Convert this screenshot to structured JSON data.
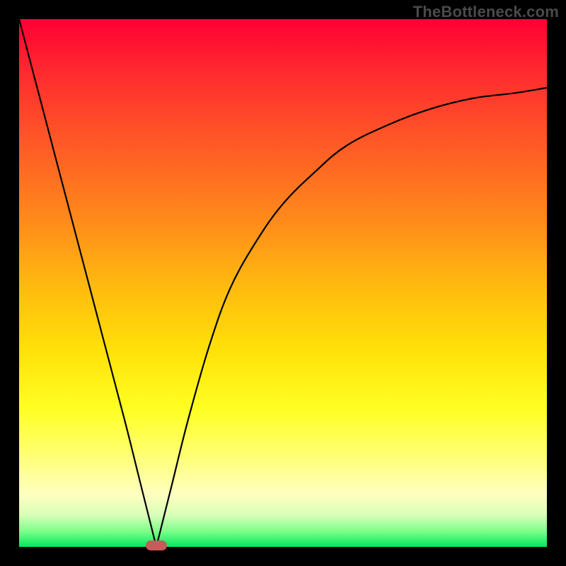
{
  "watermark": "TheBottleneck.com",
  "colors": {
    "page_bg": "#000000",
    "curve_stroke": "#000000",
    "marker_fill": "#c85a5a",
    "watermark_text": "#4a4a4a"
  },
  "chart_data": {
    "type": "line",
    "title": "",
    "xlabel": "",
    "ylabel": "",
    "xlim": [
      0,
      100
    ],
    "ylim": [
      0,
      100
    ],
    "legend": false,
    "grid": false,
    "vertex_x": 26,
    "series": [
      {
        "name": "curve",
        "x": [
          0,
          5,
          10,
          15,
          20,
          23,
          25,
          26,
          27,
          29,
          32,
          36,
          40,
          45,
          50,
          56,
          62,
          70,
          78,
          86,
          94,
          100
        ],
        "y": [
          100,
          81,
          62,
          43,
          24,
          12,
          4,
          0,
          4,
          12,
          24,
          38,
          49,
          58,
          65,
          71,
          76,
          80,
          83,
          85,
          86,
          87
        ]
      }
    ],
    "annotations": [
      {
        "kind": "pill-marker",
        "x": 26,
        "y": 0
      }
    ],
    "gradient_stops": [
      {
        "pos": 0.0,
        "color": "#ff0033"
      },
      {
        "pos": 0.38,
        "color": "#ff8a1a"
      },
      {
        "pos": 0.74,
        "color": "#ffff24"
      },
      {
        "pos": 1.0,
        "color": "#00e860"
      }
    ]
  }
}
